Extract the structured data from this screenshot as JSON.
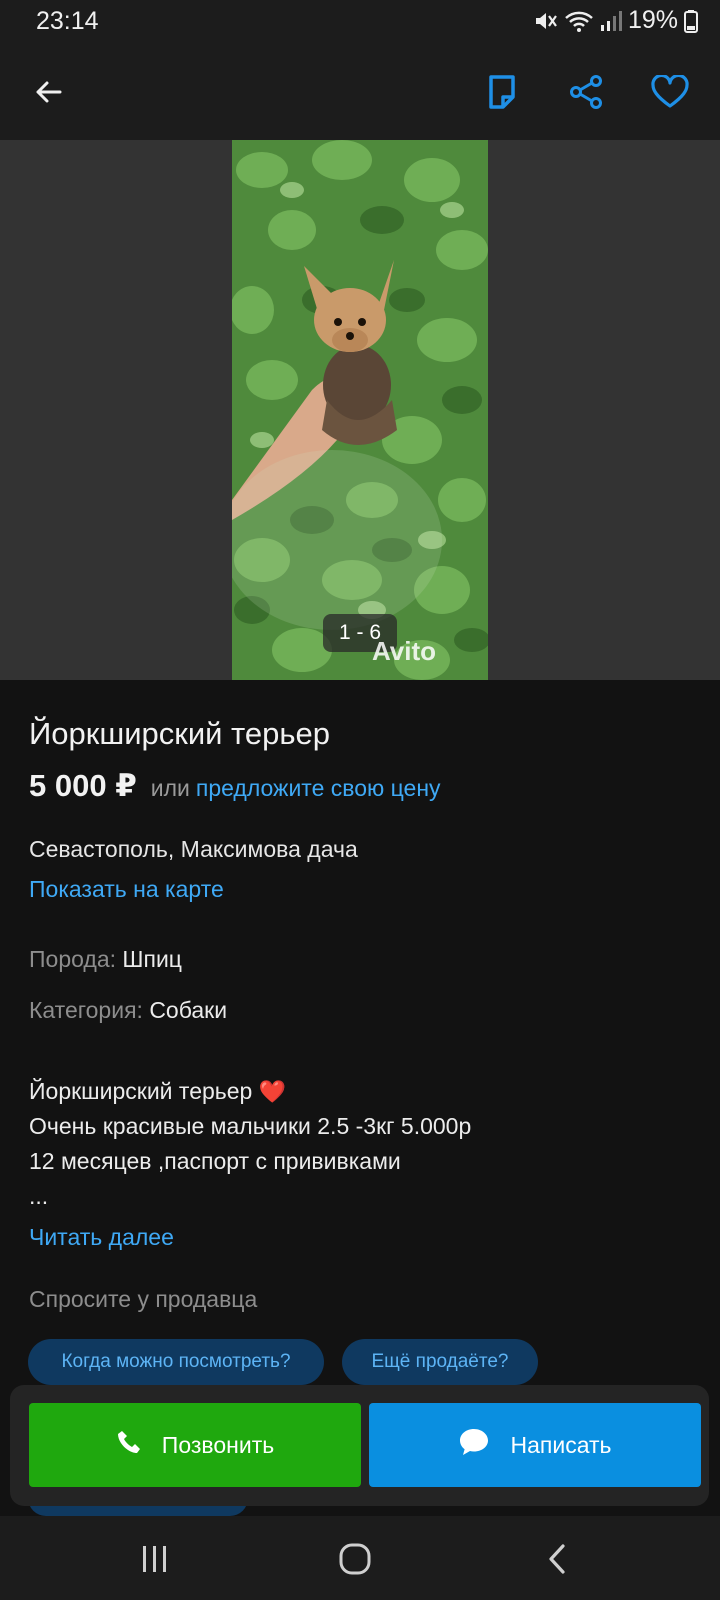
{
  "status_bar": {
    "time": "23:14",
    "battery": "19%"
  },
  "app_bar": {
    "icons": [
      "back-arrow-icon",
      "note-icon",
      "share-icon",
      "favorite-heart-icon"
    ]
  },
  "gallery": {
    "counter": "1 - 6",
    "watermark": "Avito"
  },
  "listing": {
    "title": "Йоркширский терьер",
    "price": "5 000 ₽",
    "price_or": "или",
    "price_offer": "предложите свою цену",
    "address": "Севастополь, Максимова дача",
    "show_on_map": "Показать на карте",
    "params": [
      {
        "key": "Порода:",
        "value": "Шпиц"
      },
      {
        "key": "Категория:",
        "value": "Собаки"
      }
    ],
    "description": {
      "line1": "Йоркширский терьер",
      "line1_emoji": "❤️",
      "line2": "Очень красивые мальчики 2.5 -3кг 5.000р",
      "line3": "12 месяцев ,паспорт с прививками",
      "line4": "..."
    },
    "read_more": "Читать далее",
    "ask_seller": "Спросите у продавца",
    "quick_questions": [
      "Когда можно посмотреть?",
      "Ещё продаёте?"
    ]
  },
  "actions": {
    "call": "Позвонить",
    "write": "Написать"
  },
  "colors": {
    "accent_blue": "#3fa9f5",
    "call_green": "#1fa80e",
    "write_blue": "#0a8fe0",
    "chip_bg": "#0f3960"
  }
}
